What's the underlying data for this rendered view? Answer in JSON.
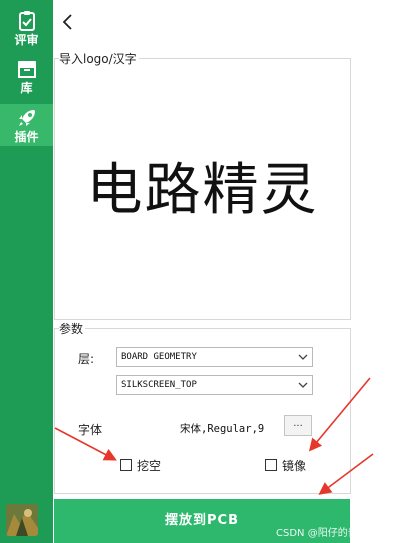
{
  "sidebar": {
    "items": [
      {
        "label": "评审",
        "icon": "clipboard-check-icon"
      },
      {
        "label": "库",
        "icon": "archive-box-icon"
      },
      {
        "label": "插件",
        "icon": "rocket-icon",
        "active": true
      }
    ]
  },
  "logo_group": {
    "title": "导入logo/汉字",
    "preview_text": "电路精灵"
  },
  "params": {
    "title": "参数",
    "layer_label": "层:",
    "layer_select": "BOARD GEOMETRY",
    "sublayer_select": "SILKSCREEN_TOP",
    "font_label": "字体",
    "font_value": "宋体,Regular,9",
    "font_button": "...",
    "hollow_label": "挖空",
    "mirror_label": "镜像"
  },
  "place_button": "摆放到PCB",
  "watermark": "CSDN @阳仔的普级之路",
  "colors": {
    "sidebar": "#1e9b55",
    "sidebar_active": "#37b86b",
    "button": "#2db86e",
    "arrow": "#e5382a"
  }
}
